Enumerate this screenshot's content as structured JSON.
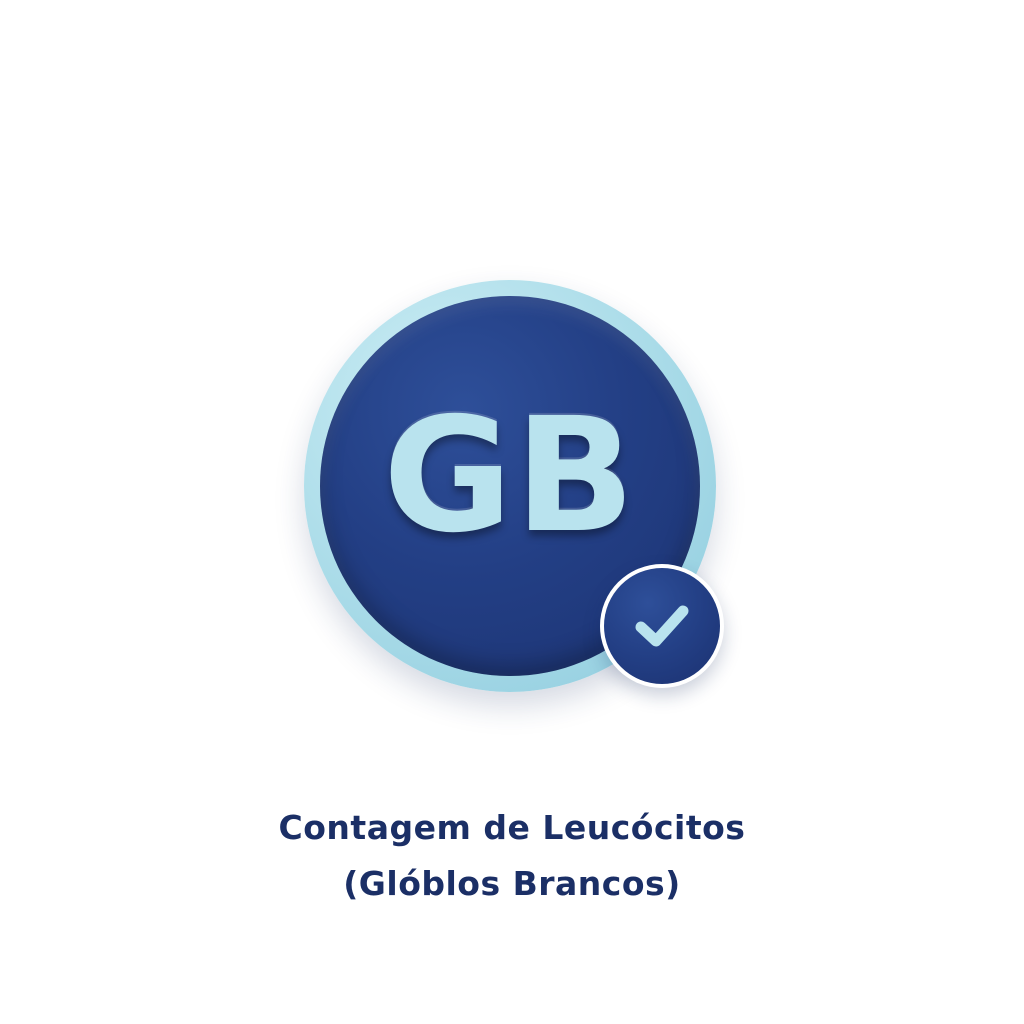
{
  "badge": {
    "letters": "GB",
    "colors": {
      "ring": "#a9dbe8",
      "disk": "#233f85",
      "letters": "#b9e3ee"
    }
  },
  "status": {
    "icon": "check-icon",
    "color": "#b9e3ee"
  },
  "caption": {
    "line1": "Contagem de Leucócitos",
    "line2": "(Glóblos Brancos)",
    "color": "#1b2f66"
  }
}
